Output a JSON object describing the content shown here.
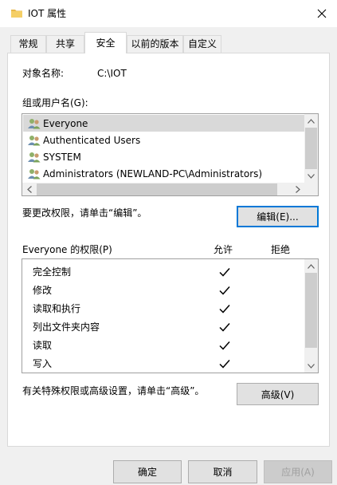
{
  "window": {
    "title": "IOT 属性",
    "icon": "folder-icon",
    "close_icon": "close-icon"
  },
  "tabs": [
    {
      "label": "常规",
      "active": false
    },
    {
      "label": "共享",
      "active": false
    },
    {
      "label": "安全",
      "active": true
    },
    {
      "label": "以前的版本",
      "active": false
    },
    {
      "label": "自定义",
      "active": false
    }
  ],
  "object": {
    "label": "对象名称:",
    "value": "C:\\IOT"
  },
  "groups": {
    "label": "组或用户名(G):",
    "items": [
      {
        "name": "Everyone",
        "selected": true
      },
      {
        "name": "Authenticated Users",
        "selected": false
      },
      {
        "name": "SYSTEM",
        "selected": false
      },
      {
        "name": "Administrators (NEWLAND-PC\\Administrators)",
        "selected": false
      }
    ]
  },
  "edit": {
    "hint": "要更改权限，请单击“编辑”。",
    "button": "编辑(E)..."
  },
  "permissions": {
    "title": "Everyone 的权限(P)",
    "allow_header": "允许",
    "deny_header": "拒绝",
    "rows": [
      {
        "name": "完全控制",
        "allow": true,
        "deny": false
      },
      {
        "name": "修改",
        "allow": true,
        "deny": false
      },
      {
        "name": "读取和执行",
        "allow": true,
        "deny": false
      },
      {
        "name": "列出文件夹内容",
        "allow": true,
        "deny": false
      },
      {
        "name": "读取",
        "allow": true,
        "deny": false
      },
      {
        "name": "写入",
        "allow": true,
        "deny": false
      }
    ]
  },
  "advanced": {
    "hint": "有关特殊权限或高级设置，请单击“高级”。",
    "button": "高级(V)"
  },
  "footer": {
    "ok": "确定",
    "cancel": "取消",
    "apply": "应用(A)"
  },
  "colors": {
    "focus_border": "#0078d7",
    "selection": "#d9d9d9",
    "window_bg": "#f0f0f0"
  }
}
